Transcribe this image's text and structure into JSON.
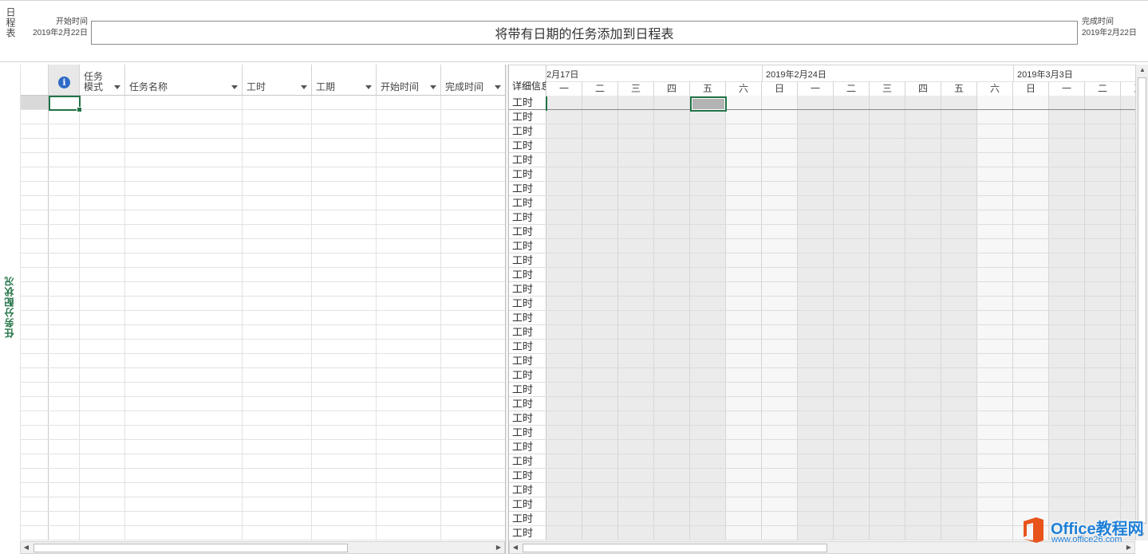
{
  "timeline": {
    "label": "日程表",
    "start_label": "开始时间",
    "start_date": "2019年2月22日",
    "finish_label": "完成时间",
    "finish_date": "2019年2月22日",
    "placeholder_text": "将带有日期的任务添加到日程表"
  },
  "side_label": "任务分配状况",
  "grid": {
    "columns": [
      {
        "id": "info",
        "label": "",
        "icon": "info-icon"
      },
      {
        "id": "mode",
        "label": "任务模式"
      },
      {
        "id": "name",
        "label": "任务名称"
      },
      {
        "id": "work",
        "label": "工时"
      },
      {
        "id": "duration",
        "label": "工期"
      },
      {
        "id": "start",
        "label": "开始时间"
      },
      {
        "id": "finish",
        "label": "完成时间"
      }
    ]
  },
  "usage": {
    "detail_header": "详细信息",
    "week_labels": [
      "2月17日",
      "2019年2月24日",
      "2019年3月3日"
    ],
    "days": [
      "一",
      "二",
      "三",
      "四",
      "五",
      "六",
      "日",
      "一",
      "二",
      "三",
      "四",
      "五",
      "六",
      "日",
      "一",
      "二",
      "三"
    ],
    "row_label": "工时",
    "row_count": 31
  },
  "colors": {
    "accent": "#217346",
    "work_day": "#ebebeb",
    "off_day": "#f7f7f7",
    "info_icon": "#2e6bc6",
    "watermark_orange": "#e8541c",
    "watermark_blue": "#1f7fd6"
  },
  "watermark": {
    "title": "Office教程网",
    "url": "www.office26.com"
  }
}
